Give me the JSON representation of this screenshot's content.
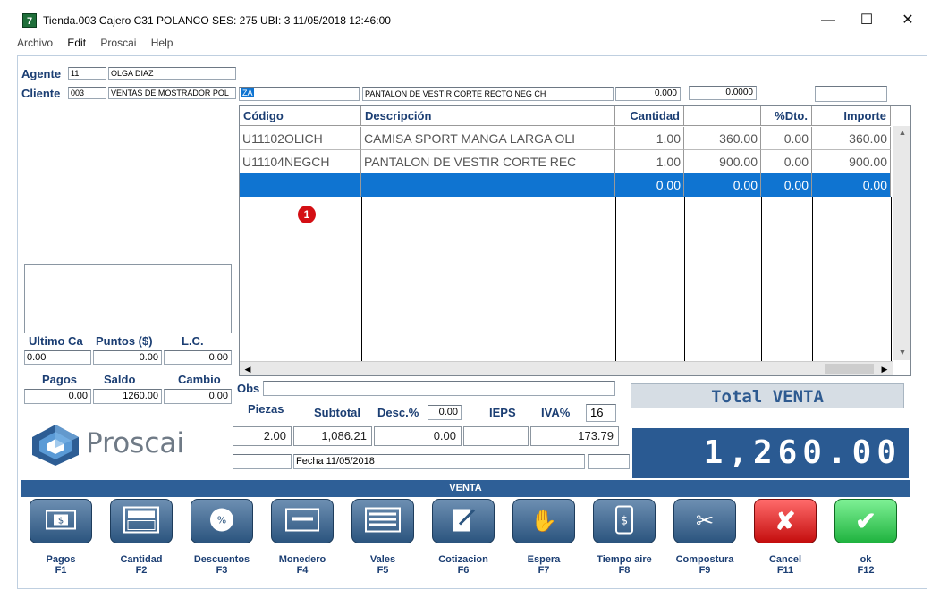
{
  "window": {
    "title": "Tienda.003  Cajero C31  POLANCO    SES: 275   UBI: 3    11/05/2018 12:46:00",
    "icon_glyph": "7",
    "minimize": "—",
    "maximize": "☐",
    "close": "✕"
  },
  "menu": [
    "Archivo",
    "Edit",
    "Proscai",
    "Help"
  ],
  "agente": {
    "label": "Agente",
    "code": "11",
    "name": "OLGA DIAZ"
  },
  "cliente": {
    "label": "Cliente",
    "code": "003",
    "name": "VENTAS DE MOSTRADOR POL"
  },
  "entry": {
    "code": "ZA",
    "description": "PANTALON DE VESTIR CORTE RECTO NEG CH",
    "qty": "0.000",
    "price": "0.0000",
    "extra": ""
  },
  "grid": {
    "headers": [
      "Código",
      "Descripción",
      "Cantidad",
      "",
      "%Dto.",
      "Importe"
    ],
    "rows": [
      {
        "codigo": "U11102OLICH",
        "descripcion": "CAMISA SPORT MANGA LARGA OLI",
        "cantidad": "1.00",
        "precio": "360.00",
        "dto": "0.00",
        "importe": "360.00"
      },
      {
        "codigo": "U11104NEGCH",
        "descripcion": "PANTALON DE VESTIR CORTE REC",
        "cantidad": "1.00",
        "precio": "900.00",
        "dto": "0.00",
        "importe": "900.00"
      },
      {
        "codigo": "",
        "descripcion": "",
        "cantidad": "0.00",
        "precio": "0.00",
        "dto": "0.00",
        "importe": "0.00"
      }
    ],
    "badge": "1"
  },
  "left_stats": {
    "h1": "Ultimo Ca",
    "h2": "Puntos ($)",
    "h3": "L.C.",
    "v1": "0.00",
    "v2": "0.00",
    "v3": "0.00",
    "h4": "Pagos",
    "h5": "Saldo",
    "h6": "Cambio",
    "v4": "0.00",
    "v5": "1260.00",
    "v6": "0.00"
  },
  "logo_text": "Proscai",
  "obs_label": "Obs",
  "totals_row": {
    "piezas_label": "Piezas",
    "subtotal_label": "Subtotal",
    "desc_label": "Desc.%",
    "desc_pct": "0.00",
    "ieps_label": "IEPS",
    "iva_label": "IVA%",
    "iva_pct": "16",
    "piezas": "2.00",
    "subtotal": "1,086.21",
    "desc": "0.00",
    "ieps": "",
    "iva": "173.79"
  },
  "fecha": "Fecha 11/05/2018",
  "total_label": "Total VENTA",
  "total_value": "1,260.00",
  "mode_bar": "VENTA",
  "buttons": [
    {
      "label": "Pagos",
      "key": "F1",
      "icon": "cash-icon"
    },
    {
      "label": "Cantidad",
      "key": "F2",
      "icon": "calculator-icon"
    },
    {
      "label": "Descuentos",
      "key": "F3",
      "icon": "percent-badge-icon"
    },
    {
      "label": "Monedero",
      "key": "F4",
      "icon": "card-icon"
    },
    {
      "label": "Vales",
      "key": "F5",
      "icon": "voucher-icon"
    },
    {
      "label": "Cotizacion",
      "key": "F6",
      "icon": "edit-document-icon"
    },
    {
      "label": "Espera",
      "key": "F7",
      "icon": "hand-icon"
    },
    {
      "label": "Tiempo aire",
      "key": "F8",
      "icon": "phone-dollar-icon"
    },
    {
      "label": "Compostura",
      "key": "F9",
      "icon": "scissors-icon"
    },
    {
      "label": "Cancel",
      "key": "F11",
      "icon": "x-icon"
    },
    {
      "label": "ok",
      "key": "F12",
      "icon": "check-icon"
    }
  ],
  "colors": {
    "accent": "#2e5f97",
    "selection": "#0f74d1",
    "label": "#1b3e73"
  }
}
